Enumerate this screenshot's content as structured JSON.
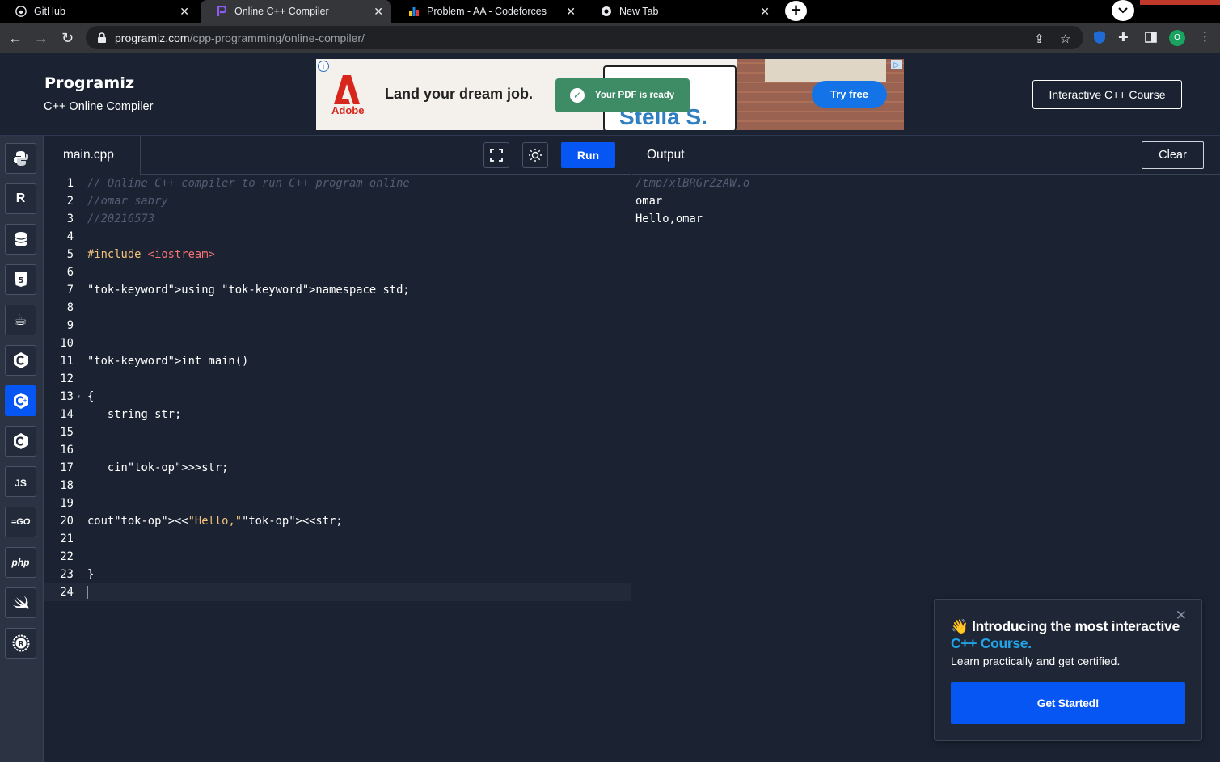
{
  "browser": {
    "tabs": [
      {
        "title": "GitHub"
      },
      {
        "title": "Online C++ Compiler"
      },
      {
        "title": "Problem - AA - Codeforces"
      },
      {
        "title": "New Tab"
      }
    ],
    "url_host": "programiz.com",
    "url_path": "/cpp-programming/online-compiler/",
    "profile_initial": "O"
  },
  "header": {
    "logo": "Programiz",
    "subtitle": "C++ Online Compiler",
    "course_button": "Interactive C++ Course"
  },
  "ad": {
    "brand": "Adobe",
    "headline": "Land your dream job.",
    "toast": "Your PDF is ready",
    "name_text": "Stella S.",
    "cta": "Try free"
  },
  "sidebar": {
    "languages": [
      {
        "name": "python",
        "label": "Py"
      },
      {
        "name": "r",
        "label": "R"
      },
      {
        "name": "sql",
        "label": "SQL"
      },
      {
        "name": "html",
        "label": "5"
      },
      {
        "name": "java",
        "label": "☕"
      },
      {
        "name": "c",
        "label": "C"
      },
      {
        "name": "cpp",
        "label": "C+",
        "active": true
      },
      {
        "name": "csharp",
        "label": "C#"
      },
      {
        "name": "javascript",
        "label": "JS"
      },
      {
        "name": "go",
        "label": "GO"
      },
      {
        "name": "php",
        "label": "php"
      },
      {
        "name": "swift",
        "label": "swift"
      },
      {
        "name": "rust",
        "label": "R"
      }
    ]
  },
  "editor": {
    "filename": "main.cpp",
    "run_label": "Run",
    "lines": [
      {
        "n": "1",
        "text": "// Online C++ compiler to run C++ program online"
      },
      {
        "n": "2",
        "text": "//omar sabry"
      },
      {
        "n": "3",
        "text": "//20216573"
      },
      {
        "n": "4",
        "text": ""
      },
      {
        "n": "5",
        "text": "#include <iostream>"
      },
      {
        "n": "6",
        "text": ""
      },
      {
        "n": "7",
        "text": "using namespace std;"
      },
      {
        "n": "8",
        "text": ""
      },
      {
        "n": "9",
        "text": ""
      },
      {
        "n": "10",
        "text": ""
      },
      {
        "n": "11",
        "text": "int main()"
      },
      {
        "n": "12",
        "text": ""
      },
      {
        "n": "13",
        "text": "{"
      },
      {
        "n": "14",
        "text": "   string str;"
      },
      {
        "n": "15",
        "text": ""
      },
      {
        "n": "16",
        "text": ""
      },
      {
        "n": "17",
        "text": "   cin>>str;"
      },
      {
        "n": "18",
        "text": ""
      },
      {
        "n": "19",
        "text": ""
      },
      {
        "n": "20",
        "text": "cout<<\"Hello,\"<<str;"
      },
      {
        "n": "21",
        "text": ""
      },
      {
        "n": "22",
        "text": ""
      },
      {
        "n": "23",
        "text": "}"
      },
      {
        "n": "24",
        "text": ""
      }
    ]
  },
  "output": {
    "title": "Output",
    "clear_label": "Clear",
    "lines": [
      {
        "text": "/tmp/xlBRGrZzAW.o",
        "kind": "path"
      },
      {
        "text": "omar",
        "kind": "text"
      },
      {
        "text": "Hello,omar",
        "kind": "text"
      }
    ]
  },
  "promo": {
    "emoji": "👋",
    "title_part1": "Introducing the most interactive ",
    "title_highlight": "C++ Course.",
    "subtitle": "Learn practically and get certified.",
    "button": "Get Started!"
  },
  "colors": {
    "bg": "#1b2332",
    "accent": "#0556f3",
    "comment": "#525d73",
    "keyword": "#f2c27a",
    "string": "#f47373"
  }
}
